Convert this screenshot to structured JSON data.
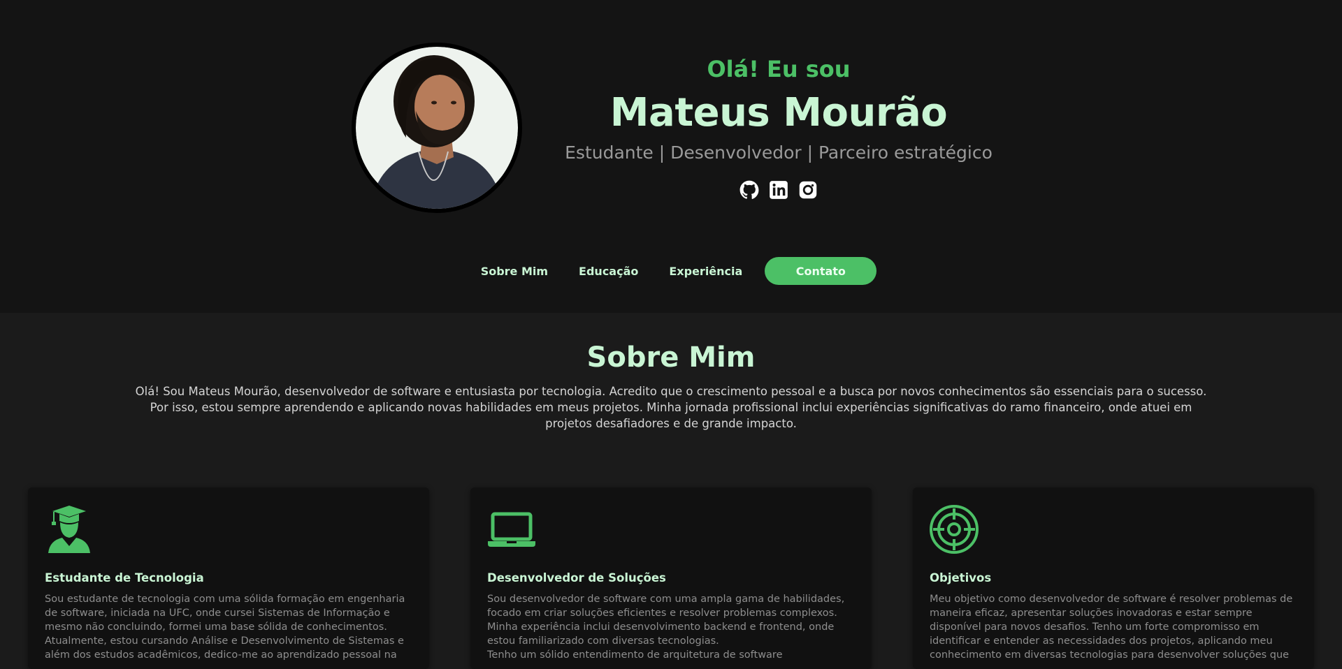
{
  "colors": {
    "accent": "#4cc066",
    "mint": "#c9f5d4",
    "header_bg": "#141414",
    "page_bg": "#1b1b1b",
    "card_bg": "#111111"
  },
  "hero": {
    "greeting": "Olá! Eu sou",
    "name": "Mateus Mourão",
    "roles": "Estudante | Desenvolvedor | Parceiro estratégico",
    "socials": [
      {
        "icon": "github-icon"
      },
      {
        "icon": "linkedin-icon"
      },
      {
        "icon": "instagram-icon"
      }
    ]
  },
  "nav": {
    "items": [
      "Sobre Mim",
      "Educação",
      "Experiência"
    ],
    "cta": "Contato"
  },
  "about": {
    "title": "Sobre Mim",
    "text": "Olá! Sou Mateus Mourão, desenvolvedor de software e entusiasta por tecnologia. Acredito que o crescimento pessoal e a busca por novos conhecimentos são essenciais para o sucesso. Por isso, estou sempre aprendendo e aplicando novas habilidades em meus projetos. Minha jornada profissional inclui experiências significativas do ramo financeiro, onde atuei em projetos desafiadores e de grande impacto."
  },
  "cards": [
    {
      "icon": "graduate-icon",
      "title": "Estudante de Tecnologia",
      "text": "Sou estudante de tecnologia com uma sólida formação em engenharia de software, iniciada na UFC, onde cursei Sistemas de Informação e mesmo não concluindo, formei uma base sólida de conhecimentos. Atualmente, estou cursando Análise e Desenvolvimento de Sistemas e além dos estudos acadêmicos, dedico-me ao aprendizado pessoal na"
    },
    {
      "icon": "laptop-icon",
      "title": "Desenvolvedor de Soluções",
      "text": "Sou desenvolvedor de software com uma ampla gama de habilidades, focado em criar soluções eficientes e resolver problemas complexos. Minha experiência inclui desenvolvimento backend e frontend, onde estou familiarizado com diversas tecnologias.\nTenho um sólido entendimento de arquitetura de software"
    },
    {
      "icon": "target-icon",
      "title": "Objetivos",
      "text": "Meu objetivo como desenvolvedor de software é resolver problemas de maneira eficaz, apresentar soluções inovadoras e estar sempre disponível para novos desafios. Tenho um forte compromisso em identificar e entender as necessidades dos projetos, aplicando meu conhecimento em diversas tecnologias para desenvolver soluções que"
    }
  ]
}
